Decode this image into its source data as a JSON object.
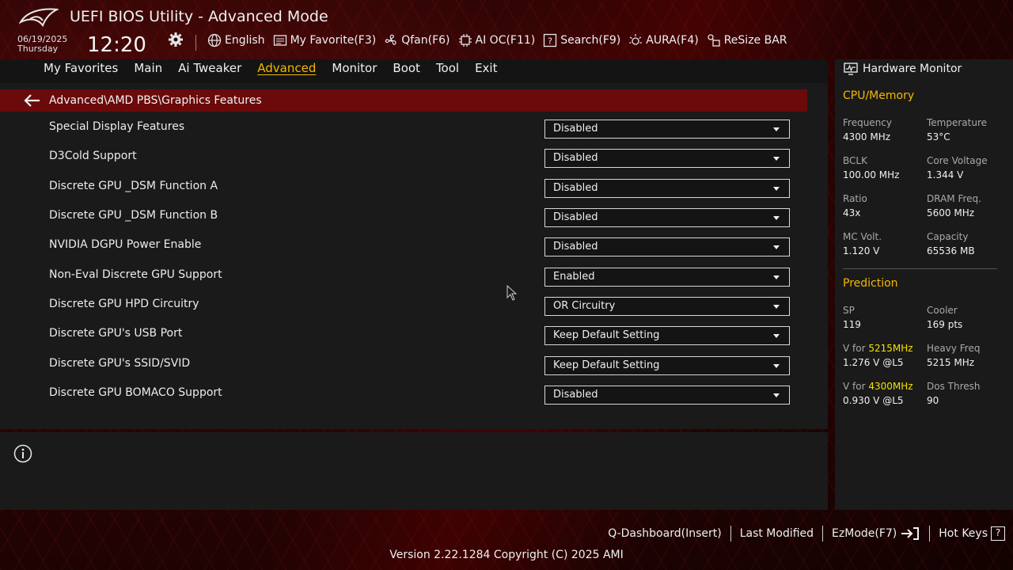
{
  "header": {
    "title": "UEFI BIOS Utility - Advanced Mode",
    "date": "06/19/2025",
    "day": "Thursday",
    "time": "12:20",
    "toolbar": [
      {
        "label": "English",
        "icon": "globe-icon"
      },
      {
        "label": "My Favorite(F3)",
        "icon": "favorite-icon"
      },
      {
        "label": "Qfan(F6)",
        "icon": "fan-icon"
      },
      {
        "label": "AI OC(F11)",
        "icon": "ai-oc-icon"
      },
      {
        "label": "Search(F9)",
        "icon": "search-icon"
      },
      {
        "label": "AURA(F4)",
        "icon": "aura-icon"
      },
      {
        "label": "ReSize BAR",
        "icon": "resize-bar-icon"
      }
    ]
  },
  "nav": {
    "items": [
      "My Favorites",
      "Main",
      "Ai Tweaker",
      "Advanced",
      "Monitor",
      "Boot",
      "Tool",
      "Exit"
    ],
    "active": "Advanced"
  },
  "breadcrumb": "Advanced\\AMD PBS\\Graphics Features",
  "settings": [
    {
      "label": "Special Display Features",
      "value": "Disabled"
    },
    {
      "label": "D3Cold Support",
      "value": "Disabled"
    },
    {
      "label": "Discrete GPU _DSM Function A",
      "value": "Disabled"
    },
    {
      "label": "Discrete GPU _DSM Function B",
      "value": "Disabled"
    },
    {
      "label": "NVIDIA DGPU Power Enable",
      "value": "Disabled"
    },
    {
      "label": "Non-Eval Discrete GPU Support",
      "value": "Enabled"
    },
    {
      "label": "Discrete GPU HPD Circuitry",
      "value": "OR Circuitry"
    },
    {
      "label": "Discrete GPU's USB Port",
      "value": "Keep Default Setting"
    },
    {
      "label": "Discrete GPU's SSID/SVID",
      "value": "Keep Default Setting"
    },
    {
      "label": "Discrete GPU BOMACO Support",
      "value": "Disabled"
    }
  ],
  "hardware_monitor": {
    "title": "Hardware Monitor",
    "cpu_memory": {
      "heading": "CPU/Memory",
      "frequency_label": "Frequency",
      "frequency": "4300 MHz",
      "temperature_label": "Temperature",
      "temperature": "53°C",
      "bclk_label": "BCLK",
      "bclk": "100.00 MHz",
      "core_voltage_label": "Core Voltage",
      "core_voltage": "1.344 V",
      "ratio_label": "Ratio",
      "ratio": "43x",
      "dram_freq_label": "DRAM Freq.",
      "dram_freq": "5600 MHz",
      "mc_volt_label": "MC Volt.",
      "mc_volt": "1.120 V",
      "capacity_label": "Capacity",
      "capacity": "65536 MB"
    },
    "prediction": {
      "heading": "Prediction",
      "sp_label": "SP",
      "sp": "119",
      "cooler_label": "Cooler",
      "cooler": "169 pts",
      "v_for_prefix": "V for ",
      "v_for_1_freq": "5215MHz",
      "v_for_1": "1.276 V @L5",
      "heavy_freq_label": "Heavy Freq",
      "heavy_freq": "5215 MHz",
      "v_for_2_freq": "4300MHz",
      "v_for_2": "0.930 V @L5",
      "dos_thresh_label": "Dos Thresh",
      "dos_thresh": "90"
    }
  },
  "footer": {
    "q_dashboard": "Q-Dashboard(Insert)",
    "last_modified": "Last Modified",
    "ez_mode": "EzMode(F7)",
    "hot_keys": "Hot Keys",
    "hot_keys_glyph": "?",
    "version": "Version 2.22.1284 Copyright (C) 2025 AMI"
  },
  "colors": {
    "accent": "#f5b800",
    "highlight": "#f5e000",
    "breadcrumb_bg": "#6b0a0a"
  }
}
